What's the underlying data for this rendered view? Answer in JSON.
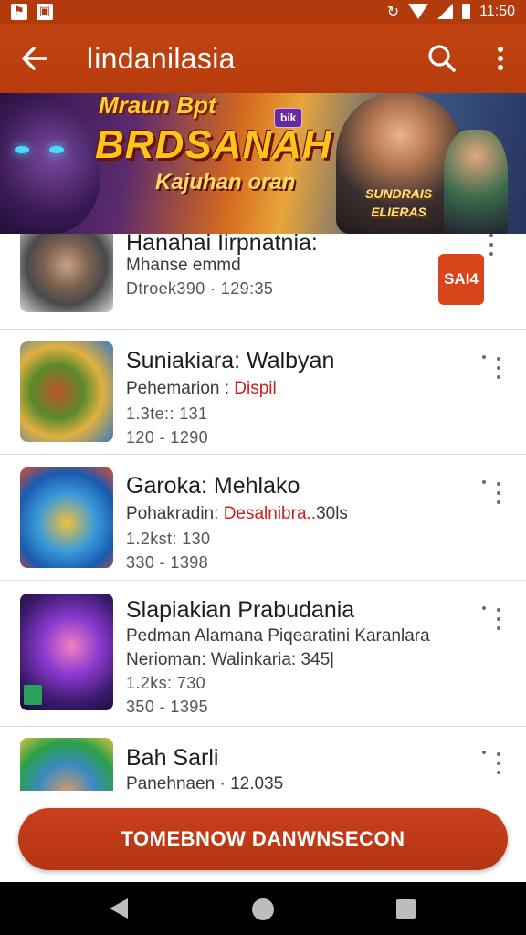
{
  "status_bar": {
    "time": "11:50",
    "icons": [
      "notification-icon",
      "notification-icon",
      "sync-icon",
      "wifi-icon",
      "signal-icon",
      "battery-icon"
    ]
  },
  "app_bar": {
    "title": "Iindanilasia",
    "back_icon": "arrow-left-icon",
    "search_icon": "search-icon",
    "more_icon": "more-vert-icon"
  },
  "banner": {
    "line1": "Mraun Bpt",
    "line2": "BRDSANAH",
    "line3": "Kajuhan oran",
    "badge": "bik",
    "emblem_line1": "SUNDRAIS",
    "emblem_line2": "ELIERAS"
  },
  "list": {
    "items": [
      {
        "title": "Hanahai Iirpnatnia:",
        "line1": "Mhanse emmd",
        "line2_prefix": "",
        "line2_red": "",
        "meta1": "Dtroek390 · 129:35",
        "meta2": "",
        "action_label": "SAI4"
      },
      {
        "title": "Suniakiara: Walbyan",
        "line1": "",
        "line2_prefix": "Pehemarion : ",
        "line2_red": "Dispil",
        "meta1": "1.3te:: 131",
        "meta2": "120 - 1290"
      },
      {
        "title": "Garoka: Mehlako",
        "line1": "",
        "line2_prefix": "Pohakradin: ",
        "line2_red": "Desalnibra..",
        "line2_suffix": "30ls",
        "meta1": "1.2kst: 130",
        "meta2": "330 - 1398"
      },
      {
        "title": "Slapiakian Prabudania",
        "line1": "Pedman Alamana  Piqearatini Karanlara",
        "line1b": "Nerioman: Walinkaria: 345|",
        "line2_prefix": "",
        "line2_red": "",
        "meta1": "1.2ks: 730",
        "meta2": "350 - 1395"
      },
      {
        "title": "Bah Sarli",
        "line1": "Panehnaen · 12.035",
        "line2_prefix": "",
        "line2_red": "",
        "meta1": "",
        "meta2": ""
      }
    ]
  },
  "cta": {
    "label": "TOMEBNOW DANWNSECON"
  },
  "colors": {
    "primary": "#b83b0d",
    "accent_red": "#d21d1d",
    "button": "#c33b16"
  }
}
